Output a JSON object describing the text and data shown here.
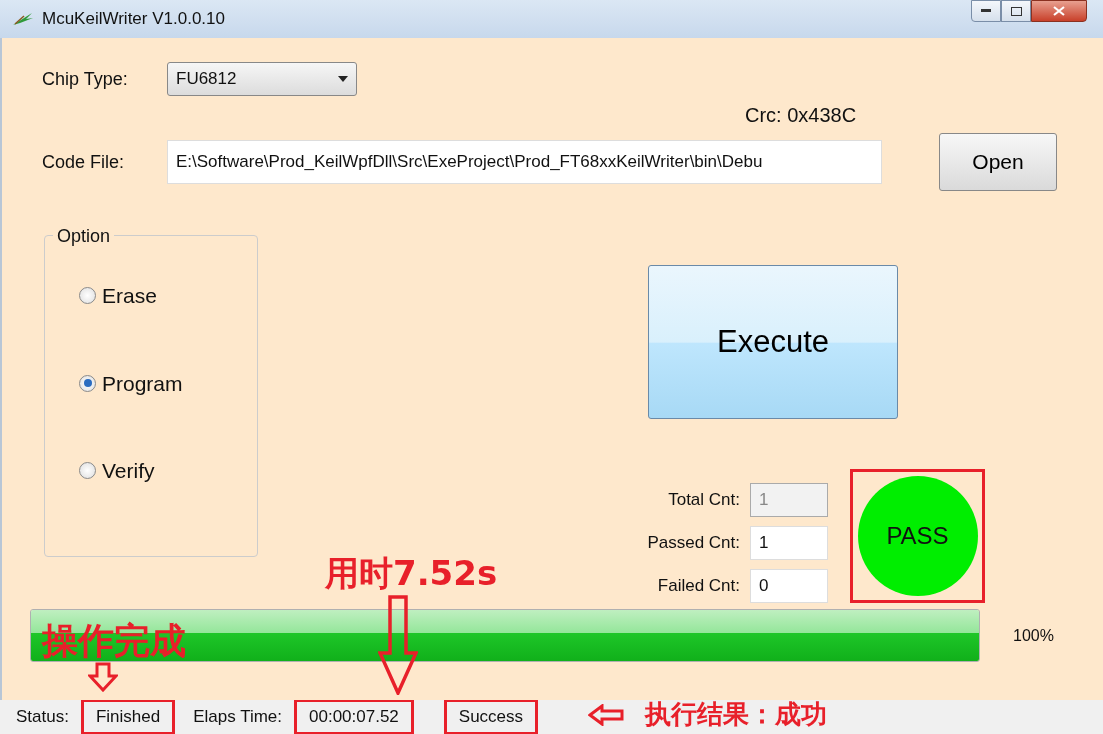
{
  "window": {
    "title": "McuKeilWriter V1.0.0.10"
  },
  "chip_type": {
    "label": "Chip Type:",
    "value": "FU6812"
  },
  "crc": "Crc: 0x438C",
  "code_file": {
    "label": "Code File:",
    "value": "E:\\Software\\Prod_KeilWpfDll\\Src\\ExeProject\\Prod_FT68xxKeilWriter\\bin\\Debu"
  },
  "open_button": "Open",
  "option": {
    "title": "Option",
    "radios": [
      {
        "label": "Erase",
        "selected": false
      },
      {
        "label": "Program",
        "selected": true
      },
      {
        "label": "Verify",
        "selected": false
      }
    ]
  },
  "execute_button": "Execute",
  "counts": [
    {
      "label": "Total Cnt:",
      "value": "1",
      "disabled": true
    },
    {
      "label": "Passed Cnt:",
      "value": "1",
      "disabled": false
    },
    {
      "label": "Failed Cnt:",
      "value": "0",
      "disabled": false
    }
  ],
  "result": {
    "text": "PASS",
    "color": "#00ee00",
    "highlighted": true
  },
  "progress": {
    "level": 1.0,
    "reading": "100%"
  },
  "status_bar": [
    {
      "label": "Status:",
      "value": "Finished",
      "highlighted": true
    },
    {
      "label": "Elaps Time:",
      "value": "00:00:07.52",
      "highlighted": true
    },
    {
      "value": "Success",
      "highlighted": true
    }
  ],
  "annotations": [
    {
      "kind": "text",
      "text": "用时7.52s"
    },
    {
      "kind": "text",
      "text": "操作完成"
    },
    {
      "kind": "small_down_arrow"
    },
    {
      "kind": "big_down_arrow"
    },
    {
      "kind": "left_arrow"
    },
    {
      "kind": "text",
      "text": "执行结果：成功"
    }
  ]
}
